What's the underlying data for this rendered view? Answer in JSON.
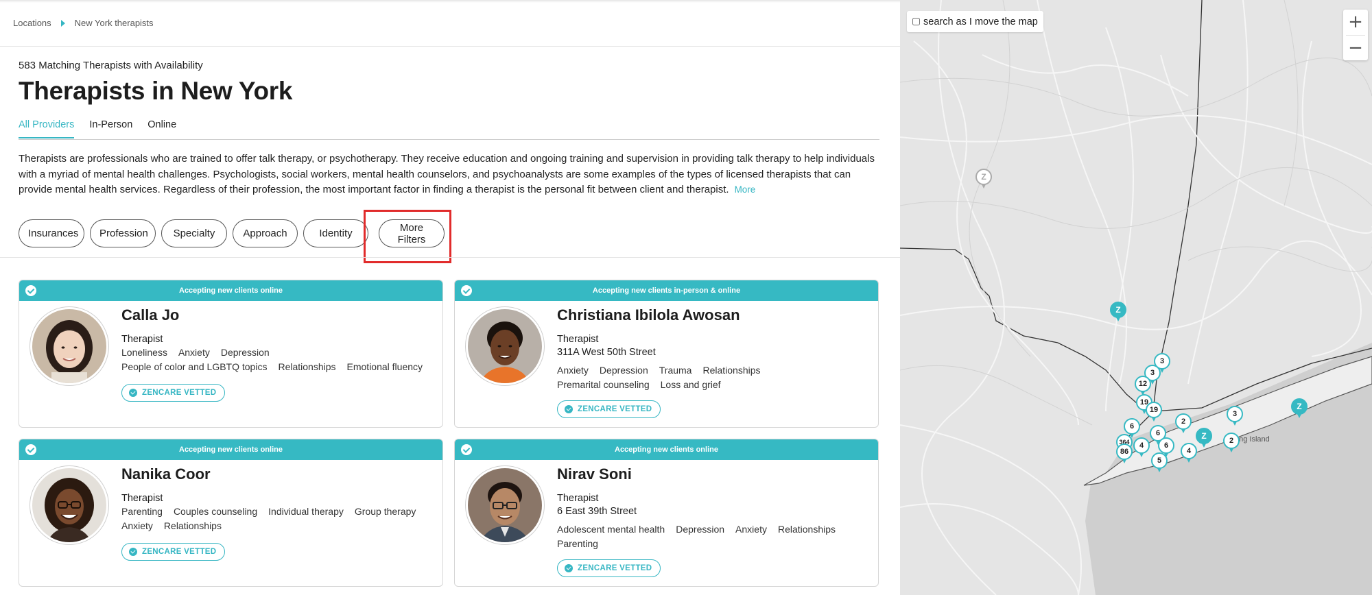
{
  "breadcrumb": {
    "items": [
      "Locations",
      "New York therapists"
    ]
  },
  "results": {
    "count_text": "583 Matching Therapists with Availability",
    "title": "Therapists in New York"
  },
  "tabs": [
    {
      "label": "All Providers",
      "active": true
    },
    {
      "label": "In-Person",
      "active": false
    },
    {
      "label": "Online",
      "active": false
    }
  ],
  "description": {
    "text": "Therapists are professionals who are trained to offer talk therapy, or psychotherapy. They receive education and ongoing training and supervision in providing talk therapy to help individuals with a myriad of mental health challenges. Psychologists, social workers, mental health counselors, and psychoanalysts are some examples of the types of licensed therapists that can provide mental health services. Regardless of their profession, the most important factor in finding a therapist is the personal fit between client and therapist.",
    "more_label": "More"
  },
  "filters": [
    "Insurances",
    "Profession",
    "Specialty",
    "Approach",
    "Identity",
    "More Filters"
  ],
  "providers": [
    {
      "banner": "Accepting new clients online",
      "name": "Calla Jo",
      "role": "Therapist",
      "address": "",
      "tags_line1": [
        "Loneliness",
        "Anxiety",
        "Depression"
      ],
      "tags_line2": [
        "People of color and LGBTQ topics",
        "Relationships",
        "Emotional fluency"
      ],
      "badge": "ZENCARE VETTED"
    },
    {
      "banner": "Accepting new clients in-person & online",
      "name": "Christiana Ibilola Awosan",
      "role": "Therapist",
      "address": "311A West 50th Street",
      "tags_line1": [
        "Anxiety",
        "Depression",
        "Trauma",
        "Relationships"
      ],
      "tags_line2": [
        "Premarital counseling",
        "Loss and grief"
      ],
      "badge": "ZENCARE VETTED"
    },
    {
      "banner": "Accepting new clients online",
      "name": "Nanika Coor",
      "role": "Therapist",
      "address": "",
      "tags_line1": [
        "Parenting",
        "Couples counseling",
        "Individual therapy",
        "Group therapy"
      ],
      "tags_line2": [
        "Anxiety",
        "Relationships"
      ],
      "badge": "ZENCARE VETTED"
    },
    {
      "banner": "Accepting new clients online",
      "name": "Nirav Soni",
      "role": "Therapist",
      "address": "6 East 39th Street",
      "tags_line1": [
        "Adolescent mental health",
        "Depression",
        "Anxiety",
        "Relationships"
      ],
      "tags_line2": [
        "Parenting"
      ],
      "badge": "ZENCARE VETTED"
    }
  ],
  "map": {
    "search_toggle_label": "search as I move the map",
    "zoom_in": "+",
    "zoom_out": "−",
    "place_label": "ong Island",
    "marker_labels": [
      "3",
      "3",
      "12",
      "19",
      "19",
      "6",
      "6",
      "6",
      "364",
      "86",
      "4",
      "5",
      "4",
      "2",
      "2",
      "3",
      "Z",
      "Z",
      "Z",
      "Z"
    ]
  },
  "colors": {
    "accent": "#36b9c3",
    "highlight": "#e12b2b",
    "map_bg": "#e5e5e5"
  }
}
